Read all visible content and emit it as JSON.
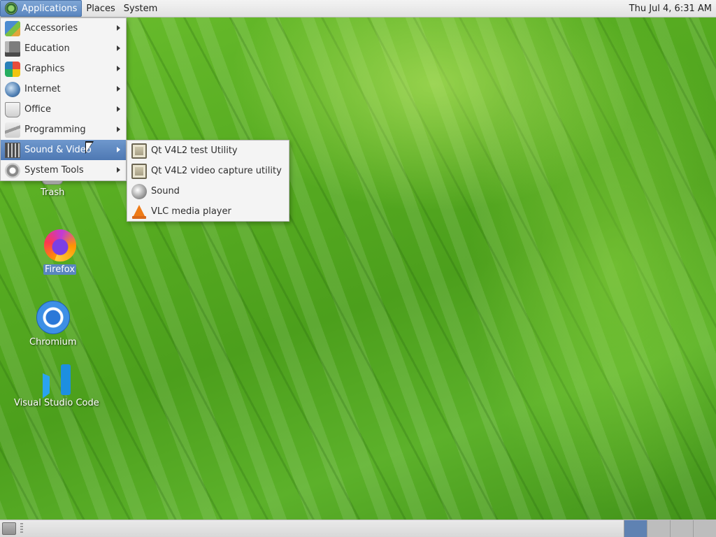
{
  "top_panel": {
    "menus": [
      {
        "label": "Applications",
        "active": true
      },
      {
        "label": "Places",
        "active": false
      },
      {
        "label": "System",
        "active": false
      }
    ],
    "clock": "Thu Jul  4,  6:31 AM"
  },
  "applications_menu": {
    "items": [
      {
        "label": "Accessories",
        "icon": "accessories-icon",
        "has_submenu": true
      },
      {
        "label": "Education",
        "icon": "education-icon",
        "has_submenu": true
      },
      {
        "label": "Graphics",
        "icon": "graphics-icon",
        "has_submenu": true
      },
      {
        "label": "Internet",
        "icon": "globe-icon",
        "has_submenu": true
      },
      {
        "label": "Office",
        "icon": "office-icon",
        "has_submenu": true
      },
      {
        "label": "Programming",
        "icon": "programming-icon",
        "has_submenu": true
      },
      {
        "label": "Sound & Video",
        "icon": "film-icon",
        "has_submenu": true,
        "selected": true
      },
      {
        "label": "System Tools",
        "icon": "gear-icon",
        "has_submenu": true
      }
    ]
  },
  "sound_video_submenu": {
    "items": [
      {
        "label": "Qt V4L2 test Utility",
        "icon": "qt-v4l2-icon"
      },
      {
        "label": "Qt V4L2 video capture utility",
        "icon": "qt-v4l2-icon"
      },
      {
        "label": "Sound",
        "icon": "sound-icon"
      },
      {
        "label": "VLC media player",
        "icon": "vlc-icon"
      }
    ]
  },
  "desktop_icons": [
    {
      "label": "Trash",
      "icon": "trash-icon"
    },
    {
      "label": "Firefox",
      "icon": "firefox-icon",
      "selected": true
    },
    {
      "label": "Chromium",
      "icon": "chromium-icon"
    },
    {
      "label": "Visual Studio Code",
      "icon": "vscode-icon"
    }
  ],
  "bottom_panel": {
    "workspaces": 4,
    "active_workspace": 1
  },
  "colors": {
    "selection": "#5a86bf",
    "panel": "#e6e6e6",
    "menu_background": "#f4f4f4",
    "wallpaper": "#58ad22"
  }
}
